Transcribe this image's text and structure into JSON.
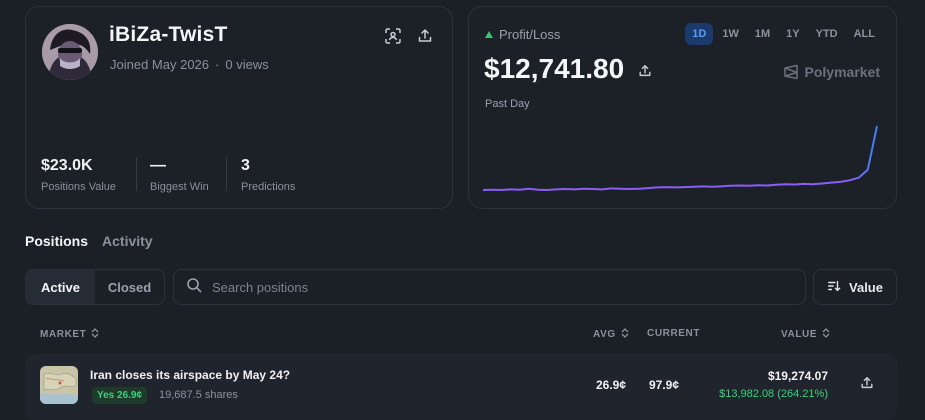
{
  "profile": {
    "username": "iBiZa-TwisT",
    "joined": "Joined May 2026",
    "separator": "·",
    "views": "0 views",
    "stats": [
      {
        "value": "$23.0K",
        "label": "Positions Value"
      },
      {
        "value": "—",
        "label": "Biggest Win"
      },
      {
        "value": "3",
        "label": "Predictions"
      }
    ]
  },
  "pl": {
    "label": "Profit/Loss",
    "value": "$12,741.80",
    "range_label": "Past Day",
    "time_tabs": [
      "1D",
      "1W",
      "1M",
      "1Y",
      "YTD",
      "ALL"
    ],
    "active_time_tab": "1D",
    "brand": "Polymarket",
    "line_color": "#8b5cf6",
    "end_color": "#3b82f6",
    "series": [
      0.62,
      0.63,
      0.62,
      0.64,
      0.63,
      0.66,
      0.63,
      0.62,
      0.64,
      0.65,
      0.64,
      0.66,
      0.65,
      0.64,
      0.67,
      0.66,
      0.65,
      0.66,
      0.68,
      0.7,
      0.71,
      0.7,
      0.71,
      0.72,
      0.73,
      0.72,
      0.73,
      0.75,
      0.76,
      0.75,
      0.77,
      0.76,
      0.78,
      0.8,
      0.79,
      0.81,
      0.8,
      0.82,
      0.85,
      0.87,
      0.92,
      1.0,
      1.25,
      2.6
    ]
  },
  "tabs": {
    "positions": "Positions",
    "activity": "Activity"
  },
  "filter": {
    "active": "Active",
    "closed": "Closed"
  },
  "search": {
    "placeholder": "Search positions"
  },
  "sort": {
    "label": "Value"
  },
  "table": {
    "headers": {
      "market": "MARKET",
      "avg": "AVG",
      "current": "CURRENT",
      "value": "VALUE"
    },
    "rows": [
      {
        "title": "Iran closes its airspace by May 24?",
        "outcome": "Yes 26.9¢",
        "shares": "19,687.5 shares",
        "avg": "26.9¢",
        "current": "97.9¢",
        "value": "$19,274.07",
        "pnl": "$13,982.08 (264.21%)"
      }
    ]
  },
  "colors": {
    "accent_green": "#3ecf7c",
    "accent_blue": "#5b9cf5",
    "background": "#1b1f26"
  }
}
